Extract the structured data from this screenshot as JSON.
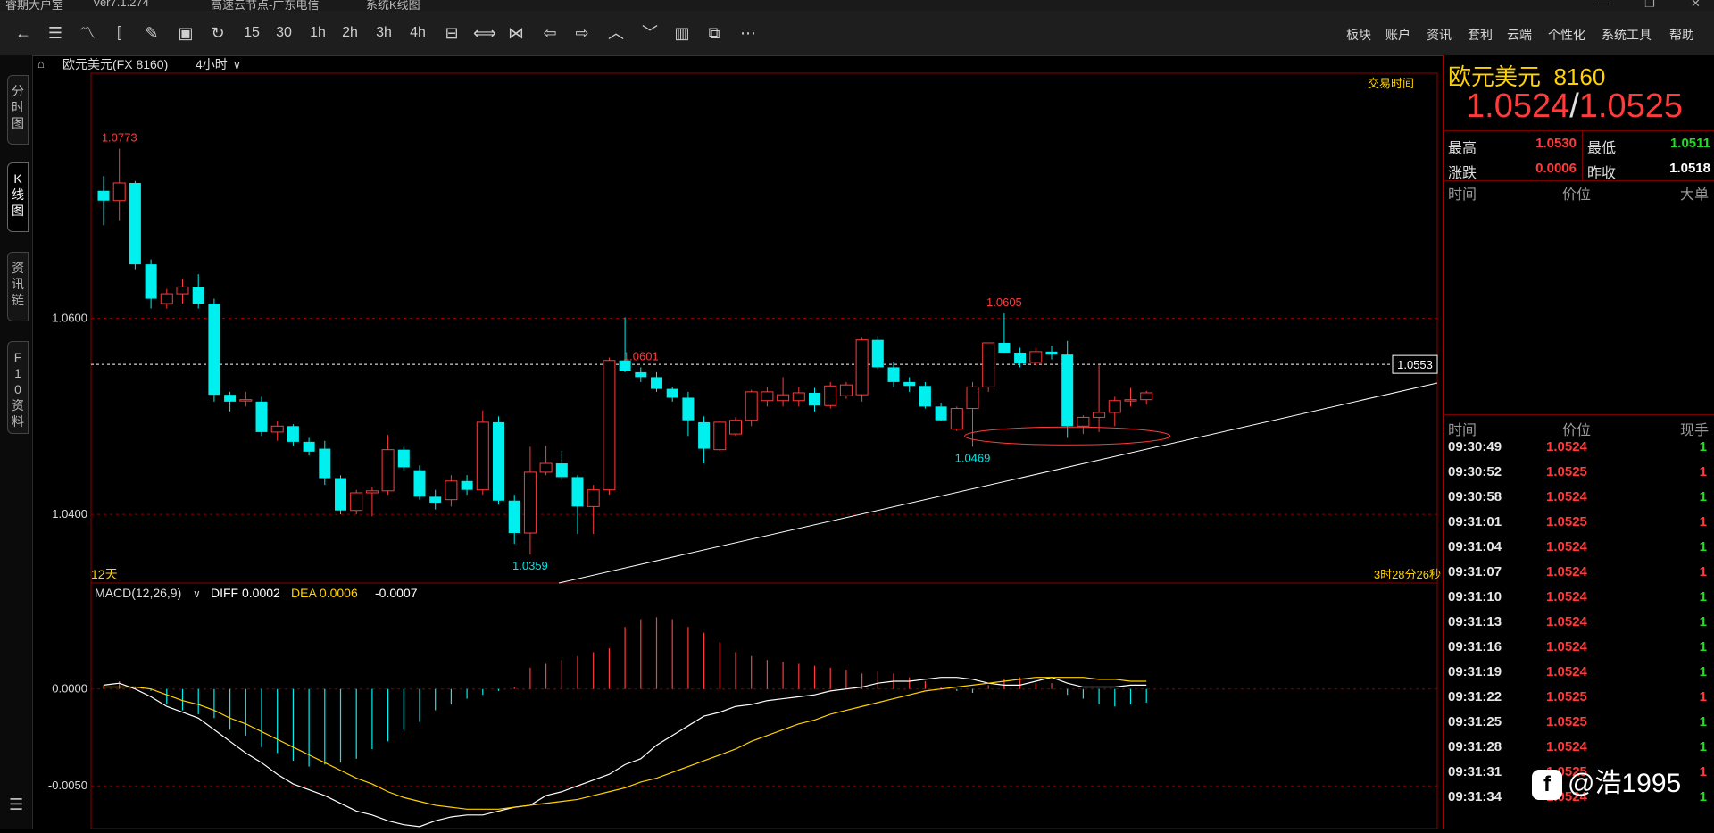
{
  "window": {
    "title_parts": [
      "睿期大户室",
      "Ver7.1.274",
      "高速云节点-广东电信",
      "系统K线图"
    ]
  },
  "toolbar": {
    "icons": [
      "back-icon",
      "list-view-icon",
      "line-chart-icon",
      "candle-icon",
      "draw-icon",
      "save-icon",
      "refresh-icon",
      "15",
      "30",
      "1h",
      "2h",
      "3h",
      "4h",
      "day-icon",
      "zoom-in-icon",
      "zoom-out-icon",
      "prev-icon",
      "next-icon",
      "up-icon",
      "down-icon",
      "layout-icon",
      "windows-icon",
      "more-icon"
    ],
    "period_labels": [
      "15",
      "30",
      "1h",
      "2h",
      "3h",
      "4h"
    ],
    "menu": [
      "板块",
      "账户",
      "资讯",
      "套利",
      "云端",
      "个性化",
      "系统工具",
      "帮助"
    ]
  },
  "sidebar": {
    "tabs": [
      "分时图",
      "K线图",
      "资讯链",
      "F10资料"
    ],
    "active_tab": "K线图"
  },
  "chart_header": {
    "symbol": "欧元美元(FX 8160)",
    "period": "4小时",
    "trading_time_label": "交易时间",
    "day_count": "12天",
    "countdown": "3时28分26秒"
  },
  "chart_data": {
    "type": "candlestick",
    "ylim": [
      1.033,
      1.085
    ],
    "y_ticks": [
      "1.0600",
      "1.0400"
    ],
    "y_tick_values": [
      1.06,
      1.04
    ],
    "current_price_label": "1.0553",
    "current_price": 1.0553,
    "high_annotations": [
      {
        "label": "1.0773",
        "index": 1
      },
      {
        "label": "1.0601",
        "index": 34
      },
      {
        "label": "1.0605",
        "index": 57
      }
    ],
    "low_annotations": [
      {
        "label": "1.0359",
        "index": 27
      },
      {
        "label": "1.0469",
        "index": 55
      }
    ],
    "candles": [
      {
        "o": 1.073,
        "h": 1.0745,
        "l": 1.0695,
        "c": 1.072
      },
      {
        "o": 1.072,
        "h": 1.0773,
        "l": 1.07,
        "c": 1.0738
      },
      {
        "o": 1.0738,
        "h": 1.074,
        "l": 1.065,
        "c": 1.0655
      },
      {
        "o": 1.0655,
        "h": 1.066,
        "l": 1.061,
        "c": 1.062
      },
      {
        "o": 1.0615,
        "h": 1.063,
        "l": 1.061,
        "c": 1.0625
      },
      {
        "o": 1.0625,
        "h": 1.064,
        "l": 1.0615,
        "c": 1.0632
      },
      {
        "o": 1.0632,
        "h": 1.0645,
        "l": 1.061,
        "c": 1.0615
      },
      {
        "o": 1.0615,
        "h": 1.062,
        "l": 1.0515,
        "c": 1.0522
      },
      {
        "o": 1.0522,
        "h": 1.0525,
        "l": 1.0505,
        "c": 1.0515
      },
      {
        "o": 1.0517,
        "h": 1.0525,
        "l": 1.051,
        "c": 1.0517
      },
      {
        "o": 1.0515,
        "h": 1.052,
        "l": 1.048,
        "c": 1.0484
      },
      {
        "o": 1.0484,
        "h": 1.0495,
        "l": 1.0475,
        "c": 1.049
      },
      {
        "o": 1.049,
        "h": 1.0492,
        "l": 1.047,
        "c": 1.0474
      },
      {
        "o": 1.0474,
        "h": 1.0478,
        "l": 1.046,
        "c": 1.0464
      },
      {
        "o": 1.0467,
        "h": 1.0475,
        "l": 1.043,
        "c": 1.0437
      },
      {
        "o": 1.0437,
        "h": 1.044,
        "l": 1.04,
        "c": 1.0404
      },
      {
        "o": 1.0404,
        "h": 1.0425,
        "l": 1.04,
        "c": 1.0422
      },
      {
        "o": 1.0422,
        "h": 1.0428,
        "l": 1.0398,
        "c": 1.0424
      },
      {
        "o": 1.0424,
        "h": 1.0481,
        "l": 1.042,
        "c": 1.0466
      },
      {
        "o": 1.0466,
        "h": 1.0469,
        "l": 1.0445,
        "c": 1.0448
      },
      {
        "o": 1.0445,
        "h": 1.045,
        "l": 1.0415,
        "c": 1.0418
      },
      {
        "o": 1.0418,
        "h": 1.0425,
        "l": 1.0405,
        "c": 1.0412
      },
      {
        "o": 1.0415,
        "h": 1.044,
        "l": 1.0408,
        "c": 1.0434
      },
      {
        "o": 1.0434,
        "h": 1.044,
        "l": 1.042,
        "c": 1.0425
      },
      {
        "o": 1.0425,
        "h": 1.0506,
        "l": 1.042,
        "c": 1.0494
      },
      {
        "o": 1.0494,
        "h": 1.05,
        "l": 1.041,
        "c": 1.0414
      },
      {
        "o": 1.0414,
        "h": 1.042,
        "l": 1.037,
        "c": 1.0381
      },
      {
        "o": 1.0381,
        "h": 1.0469,
        "l": 1.0359,
        "c": 1.0443
      },
      {
        "o": 1.0443,
        "h": 1.047,
        "l": 1.044,
        "c": 1.0452
      },
      {
        "o": 1.0452,
        "h": 1.0465,
        "l": 1.0435,
        "c": 1.0438
      },
      {
        "o": 1.0438,
        "h": 1.044,
        "l": 1.038,
        "c": 1.0408
      },
      {
        "o": 1.0408,
        "h": 1.043,
        "l": 1.038,
        "c": 1.0425
      },
      {
        "o": 1.0425,
        "h": 1.056,
        "l": 1.042,
        "c": 1.0557
      },
      {
        "o": 1.0557,
        "h": 1.0601,
        "l": 1.0545,
        "c": 1.0546
      },
      {
        "o": 1.0545,
        "h": 1.055,
        "l": 1.0535,
        "c": 1.054
      },
      {
        "o": 1.054,
        "h": 1.0545,
        "l": 1.0525,
        "c": 1.0528
      },
      {
        "o": 1.0528,
        "h": 1.053,
        "l": 1.0515,
        "c": 1.0519
      },
      {
        "o": 1.0519,
        "h": 1.0525,
        "l": 1.048,
        "c": 1.0496
      },
      {
        "o": 1.0494,
        "h": 1.05,
        "l": 1.0452,
        "c": 1.0467
      },
      {
        "o": 1.0466,
        "h": 1.0495,
        "l": 1.0465,
        "c": 1.0494
      },
      {
        "o": 1.0482,
        "h": 1.0499,
        "l": 1.048,
        "c": 1.0496
      },
      {
        "o": 1.0496,
        "h": 1.0527,
        "l": 1.049,
        "c": 1.0525
      },
      {
        "o": 1.0516,
        "h": 1.053,
        "l": 1.051,
        "c": 1.0525
      },
      {
        "o": 1.0516,
        "h": 1.054,
        "l": 1.051,
        "c": 1.0522
      },
      {
        "o": 1.0516,
        "h": 1.053,
        "l": 1.051,
        "c": 1.0524
      },
      {
        "o": 1.0524,
        "h": 1.0529,
        "l": 1.0505,
        "c": 1.0511
      },
      {
        "o": 1.0511,
        "h": 1.0535,
        "l": 1.0508,
        "c": 1.0531
      },
      {
        "o": 1.0521,
        "h": 1.0535,
        "l": 1.0518,
        "c": 1.0532
      },
      {
        "o": 1.0522,
        "h": 1.058,
        "l": 1.0515,
        "c": 1.0578
      },
      {
        "o": 1.0578,
        "h": 1.0582,
        "l": 1.0548,
        "c": 1.055
      },
      {
        "o": 1.055,
        "h": 1.0555,
        "l": 1.053,
        "c": 1.0535
      },
      {
        "o": 1.0535,
        "h": 1.054,
        "l": 1.0525,
        "c": 1.0531
      },
      {
        "o": 1.0531,
        "h": 1.0535,
        "l": 1.0508,
        "c": 1.051
      },
      {
        "o": 1.051,
        "h": 1.0514,
        "l": 1.0495,
        "c": 1.0496
      },
      {
        "o": 1.0487,
        "h": 1.051,
        "l": 1.0485,
        "c": 1.0508
      },
      {
        "o": 1.0508,
        "h": 1.0535,
        "l": 1.0469,
        "c": 1.053
      },
      {
        "o": 1.053,
        "h": 1.0575,
        "l": 1.0525,
        "c": 1.0575
      },
      {
        "o": 1.0575,
        "h": 1.0605,
        "l": 1.0565,
        "c": 1.0565
      },
      {
        "o": 1.0565,
        "h": 1.057,
        "l": 1.055,
        "c": 1.0554
      },
      {
        "o": 1.0555,
        "h": 1.057,
        "l": 1.0552,
        "c": 1.0566
      },
      {
        "o": 1.0566,
        "h": 1.0572,
        "l": 1.0558,
        "c": 1.0563
      },
      {
        "o": 1.0563,
        "h": 1.0577,
        "l": 1.0478,
        "c": 1.049
      },
      {
        "o": 1.049,
        "h": 1.0501,
        "l": 1.0482,
        "c": 1.0499
      },
      {
        "o": 1.0499,
        "h": 1.0552,
        "l": 1.0484,
        "c": 1.0504
      },
      {
        "o": 1.0504,
        "h": 1.052,
        "l": 1.049,
        "c": 1.0516
      },
      {
        "o": 1.0516,
        "h": 1.0529,
        "l": 1.051,
        "c": 1.0517
      },
      {
        "o": 1.0517,
        "h": 1.0526,
        "l": 1.0512,
        "c": 1.0524
      }
    ],
    "macd": {
      "label": "MACD(12,26,9)",
      "diff_label": "DIFF 0.0002",
      "dea_label": "DEA 0.0006",
      "macd_value": "-0.0007",
      "y_ticks": [
        "0.0000",
        "-0.0050"
      ],
      "y_tick_values": [
        0.0,
        -0.005
      ],
      "ylim": [
        -0.0072,
        0.0045
      ],
      "hist": [
        0.0002,
        0.0004,
        0.0001,
        -0.0001,
        -0.0008,
        -0.0011,
        -0.0013,
        -0.0015,
        -0.0021,
        -0.0024,
        -0.003,
        -0.0033,
        -0.0037,
        -0.004,
        -0.0039,
        -0.0038,
        -0.0036,
        -0.0031,
        -0.0027,
        -0.0021,
        -0.0017,
        -0.0011,
        -0.0008,
        -0.0005,
        -0.0003,
        -0.0001,
        0.0001,
        0.0011,
        0.0013,
        0.0015,
        0.0017,
        0.0019,
        0.0021,
        0.0032,
        0.0036,
        0.0037,
        0.0036,
        0.0032,
        0.0029,
        0.0024,
        0.0019,
        0.0017,
        0.0015,
        0.0014,
        0.0013,
        0.0012,
        0.0011,
        0.001,
        0.0008,
        0.0009,
        0.0008,
        0.0006,
        0.0004,
        0.0001,
        -0.0001,
        -0.0002,
        0.0002,
        0.0005,
        0.0006,
        0.0003,
        0.0003,
        -0.0003,
        -0.0005,
        -0.0008,
        -0.0009,
        -0.0008,
        -0.0007
      ],
      "diff": [
        0.0002,
        0.0003,
        0.0,
        -0.0004,
        -0.0009,
        -0.0012,
        -0.0015,
        -0.0021,
        -0.0027,
        -0.0033,
        -0.0038,
        -0.0044,
        -0.0049,
        -0.0052,
        -0.0055,
        -0.0059,
        -0.0063,
        -0.0065,
        -0.0068,
        -0.007,
        -0.0071,
        -0.0068,
        -0.0066,
        -0.0065,
        -0.0065,
        -0.0063,
        -0.0061,
        -0.006,
        -0.0055,
        -0.0053,
        -0.005,
        -0.0047,
        -0.0044,
        -0.0039,
        -0.0036,
        -0.0029,
        -0.0024,
        -0.0019,
        -0.0014,
        -0.0012,
        -0.0009,
        -0.0008,
        -0.0006,
        -0.0005,
        -0.0004,
        -0.0003,
        -0.0001,
        0.0,
        0.0001,
        0.0003,
        0.0004,
        0.0004,
        0.0005,
        0.0006,
        0.0006,
        0.0005,
        0.0003,
        0.0002,
        0.0002,
        0.0004,
        0.0006,
        0.0003,
        0.0001,
        0.0001,
        0.0001,
        0.0002,
        0.0002
      ],
      "dea": [
        0.0001,
        0.0001,
        0.0001,
        0.0,
        -0.0003,
        -0.0006,
        -0.0008,
        -0.0011,
        -0.0015,
        -0.0018,
        -0.0022,
        -0.0026,
        -0.003,
        -0.0034,
        -0.0038,
        -0.0042,
        -0.0046,
        -0.0049,
        -0.0053,
        -0.0056,
        -0.0058,
        -0.006,
        -0.0061,
        -0.0062,
        -0.0062,
        -0.0062,
        -0.0061,
        -0.006,
        -0.0059,
        -0.0058,
        -0.0057,
        -0.0055,
        -0.0053,
        -0.0051,
        -0.0048,
        -0.0046,
        -0.0043,
        -0.004,
        -0.0037,
        -0.0034,
        -0.0031,
        -0.0027,
        -0.0024,
        -0.0021,
        -0.0018,
        -0.0016,
        -0.0013,
        -0.0011,
        -0.0009,
        -0.0007,
        -0.0005,
        -0.0003,
        -0.0001,
        0.0,
        0.0001,
        0.0002,
        0.0003,
        0.0004,
        0.0005,
        0.0006,
        0.0006,
        0.0006,
        0.0006,
        0.0005,
        0.0005,
        0.0004,
        0.0004
      ]
    }
  },
  "quote_panel": {
    "name": "欧元美元",
    "code": "8160",
    "bid": "1.0524",
    "ask": "1.0525",
    "stats": [
      {
        "label": "最高",
        "value": "1.0530",
        "color": "#ff3b3b"
      },
      {
        "label": "最低",
        "value": "1.0511",
        "color": "#22dd22"
      },
      {
        "label": "涨跌",
        "value": "0.0006",
        "color": "#ff3b3b"
      },
      {
        "label": "昨收",
        "value": "1.0518",
        "color": "#ffffff"
      }
    ],
    "big_orders_header": [
      "时间",
      "价位",
      "大单"
    ],
    "ticks_header": [
      "时间",
      "价位",
      "现手"
    ],
    "ticks": [
      {
        "time": "09:30:49",
        "price": "1.0524",
        "vol": "1",
        "vol_color": "#22dd22"
      },
      {
        "time": "09:30:52",
        "price": "1.0525",
        "vol": "1",
        "vol_color": "#ff3b3b"
      },
      {
        "time": "09:30:58",
        "price": "1.0524",
        "vol": "1",
        "vol_color": "#22dd22"
      },
      {
        "time": "09:31:01",
        "price": "1.0525",
        "vol": "1",
        "vol_color": "#ff3b3b"
      },
      {
        "time": "09:31:04",
        "price": "1.0524",
        "vol": "1",
        "vol_color": "#22dd22"
      },
      {
        "time": "09:31:07",
        "price": "1.0524",
        "vol": "1",
        "vol_color": "#ff3b3b"
      },
      {
        "time": "09:31:10",
        "price": "1.0524",
        "vol": "1",
        "vol_color": "#22dd22"
      },
      {
        "time": "09:31:13",
        "price": "1.0524",
        "vol": "1",
        "vol_color": "#22dd22"
      },
      {
        "time": "09:31:16",
        "price": "1.0524",
        "vol": "1",
        "vol_color": "#22dd22"
      },
      {
        "time": "09:31:19",
        "price": "1.0524",
        "vol": "1",
        "vol_color": "#22dd22"
      },
      {
        "time": "09:31:22",
        "price": "1.0525",
        "vol": "1",
        "vol_color": "#ff3b3b"
      },
      {
        "time": "09:31:25",
        "price": "1.0525",
        "vol": "1",
        "vol_color": "#22dd22"
      },
      {
        "time": "09:31:28",
        "price": "1.0524",
        "vol": "1",
        "vol_color": "#22dd22"
      },
      {
        "time": "09:31:31",
        "price": "1.0525",
        "vol": "1",
        "vol_color": "#ff3b3b"
      },
      {
        "time": "09:31:34",
        "price": "1.0524",
        "vol": "1",
        "vol_color": "#22dd22"
      }
    ]
  },
  "watermark": {
    "text": "@浩1995"
  },
  "colors": {
    "up": "#ff3b3b",
    "down": "#00f0f0",
    "grid_red": "#a00000",
    "yellow": "#ffd200",
    "trendline": "#ffffff"
  }
}
